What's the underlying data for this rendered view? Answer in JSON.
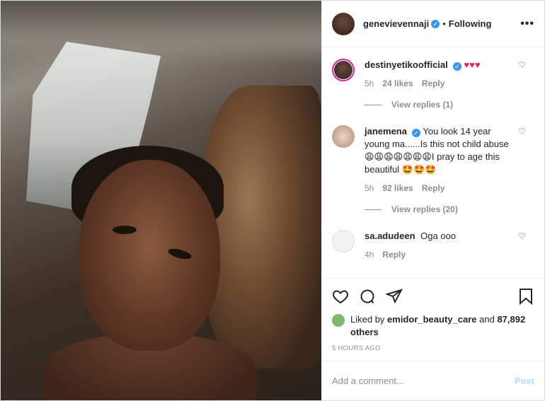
{
  "header": {
    "username": "genevievennaji",
    "verified": "✓",
    "separator": "•",
    "follow_status": "Following",
    "more": "•••"
  },
  "comments": [
    {
      "username": "destinyetikoofficial",
      "text": "♥♥♥",
      "time": "5h",
      "likes": "24 likes",
      "reply": "Reply",
      "view_replies": "View replies (1)"
    },
    {
      "username": "janemena",
      "text": "You look 14 year young ma......Is this not child abuse😩😩😩😩😩😩😩I pray to age this beautiful 🤩🤩🤩",
      "time": "5h",
      "likes": "92 likes",
      "reply": "Reply",
      "view_replies": "View replies (20)"
    },
    {
      "username": "sa.adudeen",
      "text": "Oga ooo",
      "time": "4h",
      "reply": "Reply"
    }
  ],
  "liked": {
    "prefix": "Liked by",
    "user": "emidor_beauty_care",
    "and": "and",
    "others": "87,892 others"
  },
  "timestamp": "5 HOURS AGO",
  "add_comment": {
    "placeholder": "Add a comment...",
    "post_label": "Post"
  },
  "icons": {
    "like": "heart-icon",
    "comment": "comment-icon",
    "share": "paper-plane-icon",
    "save": "bookmark-icon"
  }
}
